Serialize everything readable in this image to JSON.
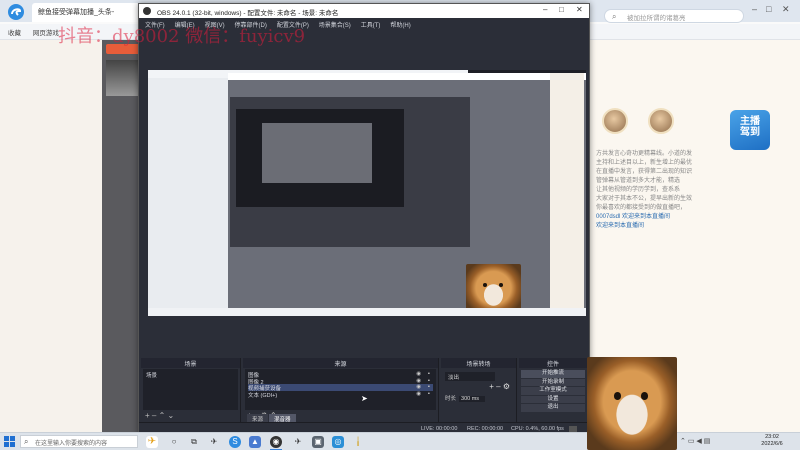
{
  "browser": {
    "tab_title": "鲸鱼接受弹幕加播_头条-",
    "search_placeholder": "被加拉所谓的诸葛亮",
    "bookmarks": [
      "收藏",
      "网页游戏"
    ],
    "right_panel": {
      "lines": [
        "方共发言心奇功更精幕线。小道的发",
        "主持和上述目以上，新生增上的最优",
        "在直播中发言，获得第二出现的知识",
        "管弹幕从管道到多大才能，精选",
        "让其他视频的学历学到，查系系",
        "大家对于其本不公，提早出新的生效",
        "你最喜欢的都接受到的做直播吧，"
      ],
      "links": [
        "0007dsdl 欢迎来到本直播间",
        "欢迎来到本直播间"
      ],
      "promo": "主播\n驾到"
    }
  },
  "watermark": "抖音：dy8002 微信：fuyicv9",
  "obs": {
    "title": "OBS 24.0.1 (32-bit, windows) - 配置文件: 未命名 - 场景: 未命名",
    "menu": [
      "文件(F)",
      "编辑(E)",
      "视图(V)",
      "停靠部件(D)",
      "配置文件(P)",
      "场景集合(S)",
      "工具(T)",
      "帮助(H)"
    ],
    "docks": {
      "scenes": {
        "title": "场景",
        "items": [
          "场景"
        ]
      },
      "sources": {
        "title": "来源",
        "items": [
          {
            "name": "图像",
            "selected": false
          },
          {
            "name": "图像 2",
            "selected": false
          },
          {
            "name": "视频捕获设备",
            "selected": true
          },
          {
            "name": "文本 (GDI+)",
            "selected": false
          }
        ]
      },
      "mixer_tab": "来源",
      "mixer_tab2": "混音器",
      "transitions": {
        "title": "场景转场",
        "selected": "淡出",
        "duration_label": "时长",
        "duration_value": "300 ms"
      },
      "controls": {
        "title": "控件",
        "buttons": [
          "开始推流",
          "开始录制",
          "工作室模式",
          "设置",
          "退出"
        ]
      }
    },
    "status": {
      "live": "LIVE: 00:00:00",
      "rec": "REC: 00:00:00",
      "cpu": "CPU: 0.4%, 60.00 fps"
    }
  },
  "taskbar": {
    "search_placeholder": "在这里输入你要搜索的内容",
    "clock_time": "23:02",
    "clock_date": "2022/6/6"
  },
  "colors": {
    "obs_bg": "#2b2e38",
    "accent_blue": "#3a6fc4",
    "watermark": "#dc1e3c"
  }
}
